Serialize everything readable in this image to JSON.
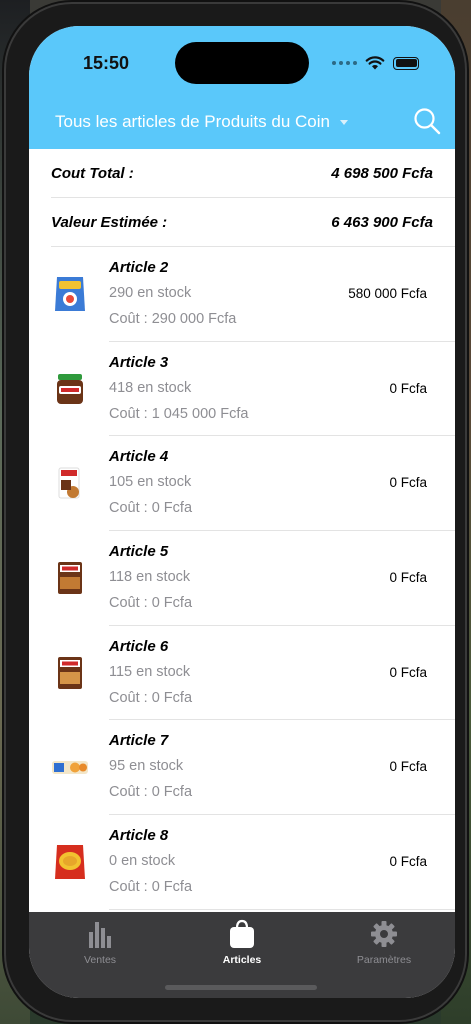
{
  "status_bar": {
    "time": "15:50"
  },
  "nav": {
    "title": "Tous les articles de Produits du Coin",
    "search_icon": "search-icon"
  },
  "summary": [
    {
      "label": "Cout Total :",
      "value": "4 698 500 Fcfa"
    },
    {
      "label": "Valeur Estimée :",
      "value": "6 463 900 Fcfa"
    }
  ],
  "articles": [
    {
      "name": "Article 2",
      "stock": "290 en stock",
      "cost": "Coût : 290 000 Fcfa",
      "value": "580 000 Fcfa",
      "thumb": "product-bag"
    },
    {
      "name": "Article 3",
      "stock": "418 en stock",
      "cost": "Coût : 1 045 000 Fcfa",
      "value": "0 Fcfa",
      "thumb": "jar"
    },
    {
      "name": "Article 4",
      "stock": "105 en stock",
      "cost": "Coût : 0 Fcfa",
      "value": "0 Fcfa",
      "thumb": "snack-pack"
    },
    {
      "name": "Article 5",
      "stock": "118 en stock",
      "cost": "Coût : 0 Fcfa",
      "value": "0 Fcfa",
      "thumb": "box"
    },
    {
      "name": "Article 6",
      "stock": "115 en stock",
      "cost": "Coût : 0 Fcfa",
      "value": "0 Fcfa",
      "thumb": "box"
    },
    {
      "name": "Article 7",
      "stock": "95 en stock",
      "cost": "Coût : 0 Fcfa",
      "value": "0 Fcfa",
      "thumb": "biscuit-pack"
    },
    {
      "name": "Article 8",
      "stock": "0 en stock",
      "cost": "Coût : 0 Fcfa",
      "value": "0 Fcfa",
      "thumb": "pasta-bag"
    }
  ],
  "tabs": [
    {
      "label": "Ventes",
      "icon": "chart-icon",
      "active": false
    },
    {
      "label": "Articles",
      "icon": "bag-icon",
      "active": true
    },
    {
      "label": "Paramètres",
      "icon": "gear-icon",
      "active": false
    }
  ],
  "colors": {
    "header": "#5ac8fa",
    "tabbar": "#3b3b3d",
    "secondary_text": "#8e8e93"
  }
}
